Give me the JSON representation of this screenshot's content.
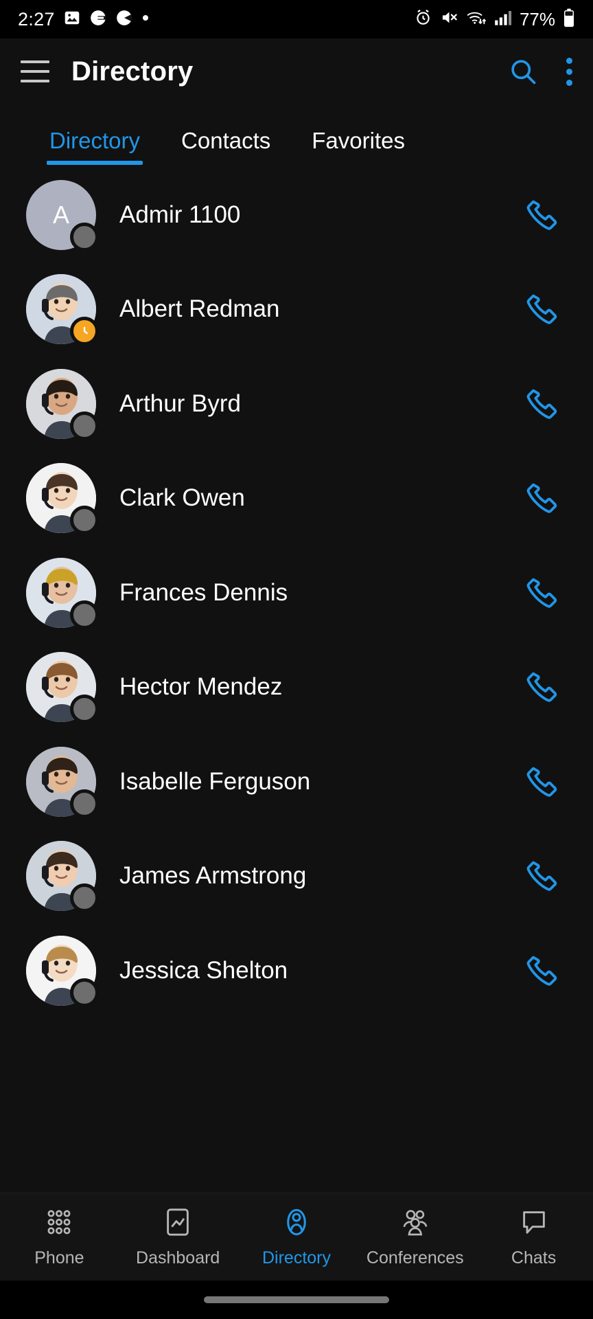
{
  "status_bar": {
    "time": "2:27",
    "battery_percent": "77%",
    "left_icons": [
      "photo-icon",
      "app-badge-icon",
      "app-badge-icon-2",
      "dot-icon"
    ],
    "right_icons": [
      "alarm-icon",
      "volume-muted-icon",
      "wifi-icon",
      "signal-icon",
      "battery-icon"
    ]
  },
  "app_bar": {
    "menu_icon": "hamburger-menu-icon",
    "title": "Directory",
    "search_icon": "search-icon",
    "overflow_icon": "more-vertical-icon",
    "accent_color": "#2196e8"
  },
  "tabs": {
    "items": [
      {
        "label": "Directory",
        "active": true
      },
      {
        "label": "Contacts",
        "active": false
      },
      {
        "label": "Favorites",
        "active": false
      }
    ]
  },
  "directory": {
    "call_icon": "phone-call-icon",
    "status_colors": {
      "offline": "#6e6e6e",
      "away": "#f5a623"
    },
    "contacts": [
      {
        "name": "Admir 1100",
        "avatar_type": "initial",
        "initial": "A",
        "avatar_bg": "#aeb2c0",
        "status": "offline"
      },
      {
        "name": "Albert Redman",
        "avatar_type": "photo",
        "avatar_bg": "#cfd8e3",
        "status": "away"
      },
      {
        "name": "Arthur Byrd",
        "avatar_type": "photo",
        "avatar_bg": "#d7d9dd",
        "status": "offline"
      },
      {
        "name": "Clark Owen",
        "avatar_type": "photo",
        "avatar_bg": "#f2f2f2",
        "status": "offline"
      },
      {
        "name": "Frances Dennis",
        "avatar_type": "photo",
        "avatar_bg": "#dde3ea",
        "status": "offline"
      },
      {
        "name": "Hector Mendez",
        "avatar_type": "photo",
        "avatar_bg": "#e2e6ea",
        "status": "offline"
      },
      {
        "name": "Isabelle Ferguson",
        "avatar_type": "photo",
        "avatar_bg": "#b9bcc4",
        "status": "offline"
      },
      {
        "name": "James Armstrong",
        "avatar_type": "photo",
        "avatar_bg": "#cdd3da",
        "status": "offline"
      },
      {
        "name": "Jessica Shelton",
        "avatar_type": "photo",
        "avatar_bg": "#f4f4f4",
        "status": "offline"
      }
    ]
  },
  "bottom_nav": {
    "items": [
      {
        "label": "Phone",
        "icon": "dialpad-icon",
        "active": false
      },
      {
        "label": "Dashboard",
        "icon": "chart-icon",
        "active": false
      },
      {
        "label": "Directory",
        "icon": "person-icon",
        "active": true
      },
      {
        "label": "Conferences",
        "icon": "group-icon",
        "active": false
      },
      {
        "label": "Chats",
        "icon": "chat-bubble-icon",
        "active": false
      }
    ]
  }
}
